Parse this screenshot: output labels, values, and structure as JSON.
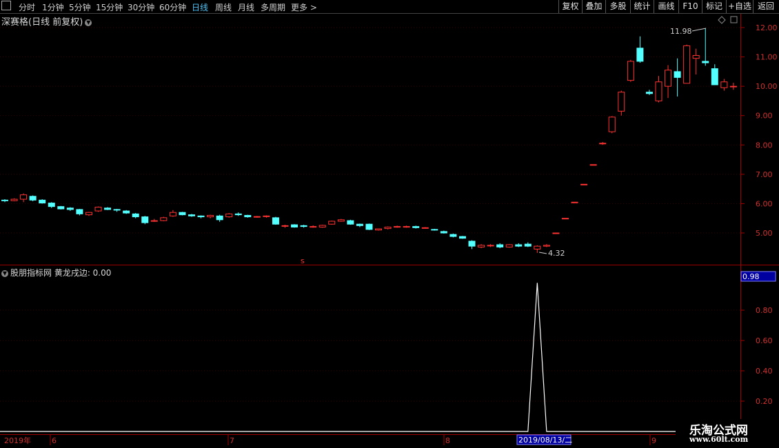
{
  "toolbar": {
    "periods": [
      "分时",
      "1分钟",
      "5分钟",
      "15分钟",
      "30分钟",
      "60分钟",
      "日线",
      "周线",
      "月线",
      "多周期",
      "更多 >"
    ],
    "active": "日线",
    "right_buttons": [
      "复权",
      "叠加",
      "多股",
      "统计",
      "画线",
      "F10",
      "标记",
      "+自选",
      "返回"
    ]
  },
  "chart": {
    "title": "深赛格(日线 前复权)",
    "high_label": "11.98",
    "low_label": "4.32",
    "marker": "s",
    "y_axis": [
      "12.00",
      "11.00",
      "10.00",
      "9.00",
      "8.00",
      "7.00",
      "6.00",
      "5.00"
    ]
  },
  "indicator": {
    "title": "股朋指标网 黄龙戌边: 0.00",
    "value_box": "0.98",
    "y_axis": [
      "0.80",
      "0.60",
      "0.40",
      "0.20"
    ]
  },
  "x_axis": {
    "labels": [
      "2019年",
      "6",
      "7",
      "8",
      "9"
    ],
    "cursor_date": "2019/08/13/二"
  },
  "watermark": {
    "title": "乐淘公式网",
    "url": "www.60lt.com"
  },
  "colors": {
    "up": "#ff3232",
    "down": "#54ffff",
    "indicator_line": "#ffffff",
    "axis": "#a00000"
  },
  "chart_data": {
    "type": "candlestick",
    "candles": [
      [
        6.12,
        6.15,
        6.05,
        6.1
      ],
      [
        6.1,
        6.18,
        6.08,
        6.15
      ],
      [
        6.15,
        6.35,
        6.05,
        6.3
      ],
      [
        6.25,
        6.28,
        6.08,
        6.12
      ],
      [
        6.12,
        6.15,
        6.0,
        6.02
      ],
      [
        6.02,
        6.05,
        5.85,
        5.9
      ],
      [
        5.9,
        5.92,
        5.8,
        5.82
      ],
      [
        5.85,
        5.88,
        5.75,
        5.8
      ],
      [
        5.8,
        5.82,
        5.6,
        5.65
      ],
      [
        5.62,
        5.72,
        5.58,
        5.7
      ],
      [
        5.75,
        5.9,
        5.72,
        5.88
      ],
      [
        5.85,
        5.88,
        5.78,
        5.8
      ],
      [
        5.8,
        5.82,
        5.72,
        5.78
      ],
      [
        5.75,
        5.78,
        5.65,
        5.68
      ],
      [
        5.65,
        5.68,
        5.5,
        5.55
      ],
      [
        5.55,
        5.58,
        5.3,
        5.35
      ],
      [
        5.4,
        5.48,
        5.38,
        5.42
      ],
      [
        5.42,
        5.55,
        5.4,
        5.52
      ],
      [
        5.58,
        5.78,
        5.55,
        5.7
      ],
      [
        5.7,
        5.72,
        5.6,
        5.62
      ],
      [
        5.62,
        5.65,
        5.55,
        5.58
      ],
      [
        5.58,
        5.6,
        5.5,
        5.55
      ],
      [
        5.55,
        5.62,
        5.5,
        5.6
      ],
      [
        5.58,
        5.62,
        5.38,
        5.45
      ],
      [
        5.55,
        5.68,
        5.52,
        5.65
      ],
      [
        5.65,
        5.7,
        5.58,
        5.62
      ],
      [
        5.6,
        5.62,
        5.52,
        5.55
      ],
      [
        5.55,
        5.58,
        5.52,
        5.56
      ],
      [
        5.56,
        5.6,
        5.52,
        5.58
      ],
      [
        5.52,
        5.55,
        5.28,
        5.3
      ],
      [
        5.25,
        5.28,
        5.18,
        5.25
      ],
      [
        5.28,
        5.3,
        5.18,
        5.2
      ],
      [
        5.25,
        5.28,
        5.18,
        5.22
      ],
      [
        5.22,
        5.26,
        5.18,
        5.22
      ],
      [
        5.2,
        5.28,
        5.18,
        5.26
      ],
      [
        5.3,
        5.42,
        5.28,
        5.4
      ],
      [
        5.4,
        5.48,
        5.38,
        5.45
      ],
      [
        5.42,
        5.45,
        5.28,
        5.3
      ],
      [
        5.3,
        5.32,
        5.2,
        5.25
      ],
      [
        5.3,
        5.32,
        5.1,
        5.12
      ],
      [
        5.1,
        5.15,
        5.08,
        5.14
      ],
      [
        5.15,
        5.22,
        5.12,
        5.2
      ],
      [
        5.2,
        5.25,
        5.18,
        5.22
      ],
      [
        5.22,
        5.25,
        5.18,
        5.22
      ],
      [
        5.22,
        5.25,
        5.15,
        5.18
      ],
      [
        5.18,
        5.2,
        5.15,
        5.18
      ],
      [
        5.12,
        5.14,
        5.08,
        5.1
      ],
      [
        5.05,
        5.08,
        4.98,
        5.0
      ],
      [
        4.95,
        4.98,
        4.85,
        4.88
      ],
      [
        4.88,
        4.9,
        4.8,
        4.82
      ],
      [
        4.72,
        4.75,
        4.45,
        4.55
      ],
      [
        4.52,
        4.62,
        4.48,
        4.58
      ],
      [
        4.58,
        4.62,
        4.52,
        4.58
      ],
      [
        4.6,
        4.65,
        4.48,
        4.52
      ],
      [
        4.52,
        4.62,
        4.5,
        4.6
      ],
      [
        4.6,
        4.65,
        4.52,
        4.55
      ],
      [
        4.62,
        4.68,
        4.52,
        4.55
      ],
      [
        4.45,
        4.58,
        4.32,
        4.55
      ],
      [
        4.55,
        4.62,
        4.52,
        4.58
      ],
      [
        5.0,
        5.0,
        5.0,
        5.0
      ],
      [
        5.5,
        5.5,
        5.5,
        5.5
      ],
      [
        6.05,
        6.05,
        6.05,
        6.05
      ],
      [
        6.66,
        6.66,
        6.66,
        6.66
      ],
      [
        7.33,
        7.33,
        7.33,
        7.33
      ],
      [
        8.06,
        8.1,
        8.0,
        8.06
      ],
      [
        8.45,
        8.98,
        8.4,
        8.95
      ],
      [
        9.15,
        9.85,
        9.0,
        9.8
      ],
      [
        10.2,
        10.9,
        10.15,
        10.85
      ],
      [
        11.3,
        11.7,
        10.8,
        10.85
      ],
      [
        9.8,
        9.88,
        9.7,
        9.75
      ],
      [
        9.5,
        10.35,
        9.45,
        10.15
      ],
      [
        10.0,
        10.72,
        9.6,
        10.55
      ],
      [
        10.5,
        10.95,
        9.65,
        10.3
      ],
      [
        10.1,
        11.42,
        10.1,
        11.38
      ],
      [
        10.95,
        11.28,
        10.4,
        11.05
      ],
      [
        10.85,
        11.98,
        10.7,
        10.8
      ],
      [
        10.6,
        10.75,
        10.05,
        10.05
      ],
      [
        9.95,
        10.25,
        9.85,
        10.15
      ],
      [
        10.0,
        10.12,
        9.88,
        10.0
      ]
    ],
    "indicator": [
      0,
      0,
      0,
      0,
      0,
      0,
      0,
      0,
      0,
      0,
      0,
      0,
      0,
      0,
      0,
      0,
      0,
      0,
      0,
      0,
      0,
      0,
      0,
      0,
      0,
      0,
      0,
      0,
      0,
      0,
      0,
      0,
      0,
      0,
      0,
      0,
      0,
      0,
      0,
      0,
      0,
      0,
      0,
      0,
      0,
      0,
      0,
      0,
      0,
      0,
      0,
      0,
      0,
      0,
      0,
      0,
      0,
      0.98,
      0,
      0,
      0,
      0,
      0,
      0,
      0,
      0,
      0,
      0,
      0,
      0,
      0,
      0,
      0,
      0,
      0,
      0,
      0,
      0,
      0
    ],
    "ylim": [
      4.0,
      12.4
    ],
    "indicator_ylim": [
      0,
      1
    ]
  }
}
